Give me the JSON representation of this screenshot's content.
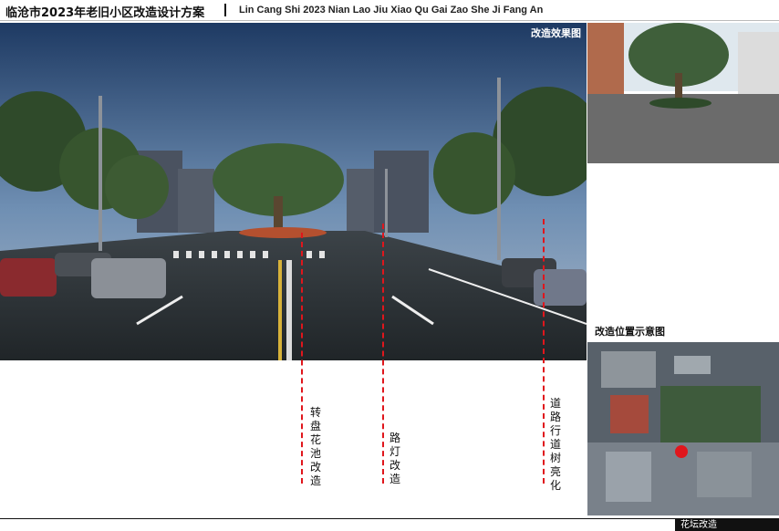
{
  "header": {
    "title_cn": "临沧市2023年老旧小区改造设计方案",
    "title_en": "Lin Cang Shi 2023 Nian Lao Jiu Xiao Qu Gai Zao She Ji Fang An"
  },
  "render": {
    "label": "改造效果图"
  },
  "location": {
    "title": "改造位置示意图"
  },
  "annotations": [
    {
      "label": "转盘花池改造"
    },
    {
      "label": "路灯改造"
    },
    {
      "label": "道路行道树亮化"
    }
  ],
  "footer": {
    "tag": "花坛改造"
  },
  "colors": {
    "accent": "#e0161c",
    "text": "#111111"
  }
}
